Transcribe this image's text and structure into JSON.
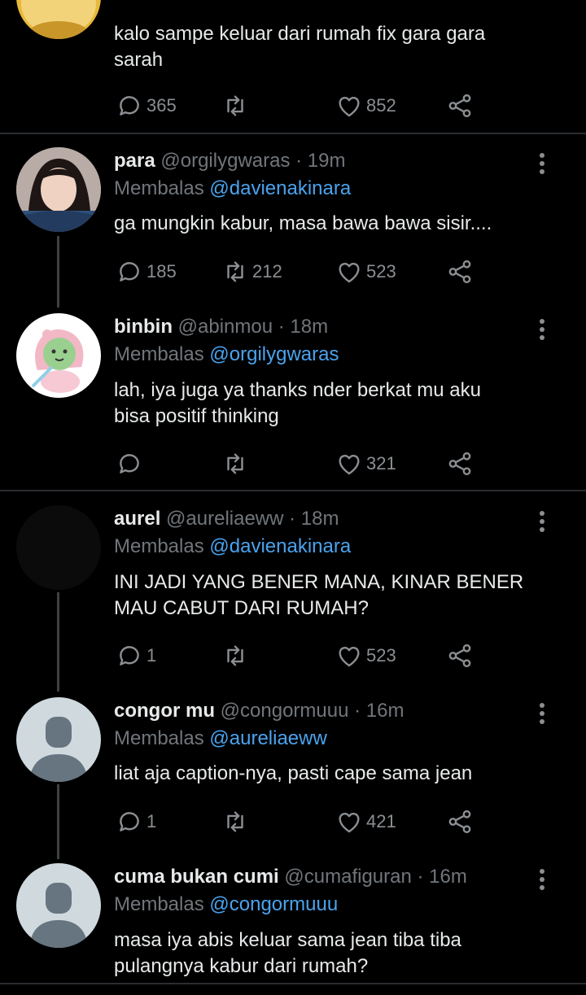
{
  "tweets": [
    {
      "name": "",
      "handle": "",
      "time": "",
      "reply_label": "",
      "reply_to": "",
      "text": [
        "kalo sampe keluar dari rumah fix gara gara",
        "sarah"
      ],
      "replies": "365",
      "retweets": "",
      "likes": "852"
    },
    {
      "name": "para",
      "handle": "@orgilygwaras",
      "time": "· 19m",
      "reply_label": "Membalas",
      "reply_to": "@davienakinara",
      "text": [
        "ga mungkin kabur, masa bawa bawa sisir...."
      ],
      "replies": "185",
      "retweets": "212",
      "likes": "523"
    },
    {
      "name": "binbin",
      "handle": "@abinmou",
      "time": "· 18m",
      "reply_label": "Membalas",
      "reply_to": "@orgilygwaras",
      "text": [
        "lah, iya juga ya thanks nder berkat mu aku",
        "bisa positif thinking"
      ],
      "replies": "",
      "retweets": "",
      "likes": "321"
    },
    {
      "name": "aurel",
      "handle": "@aureliaeww",
      "time": "· 18m",
      "reply_label": "Membalas",
      "reply_to": "@davienakinara",
      "text": [
        "INI JADI YANG BENER MANA, KINAR BENER",
        "MAU CABUT DARI RUMAH?"
      ],
      "replies": "1",
      "retweets": "",
      "likes": "523"
    },
    {
      "name": "congor mu",
      "handle": "@congormuuu",
      "time": "· 16m",
      "reply_label": "Membalas",
      "reply_to": "@aureliaeww",
      "text": [
        "liat aja caption-nya, pasti cape sama jean"
      ],
      "replies": "1",
      "retweets": "",
      "likes": "421"
    },
    {
      "name": "cuma bukan cumi",
      "handle": "@cumafiguran",
      "time": "· 16m",
      "reply_label": "Membalas",
      "reply_to": "@congormuuu",
      "text": [
        "masa iya abis keluar sama jean tiba tiba",
        "pulangnya kabur dari rumah?"
      ],
      "replies": "",
      "retweets": "",
      "likes": ""
    }
  ],
  "icons": {
    "reply": "reply-icon",
    "retweet": "retweet-icon",
    "like": "heart-icon",
    "share": "share-icon",
    "more": "more-vertical-icon"
  },
  "colors": {
    "background": "#000000",
    "mention": "#4aa3ee",
    "muted": "#71767b",
    "text": "#e7e9ea"
  }
}
